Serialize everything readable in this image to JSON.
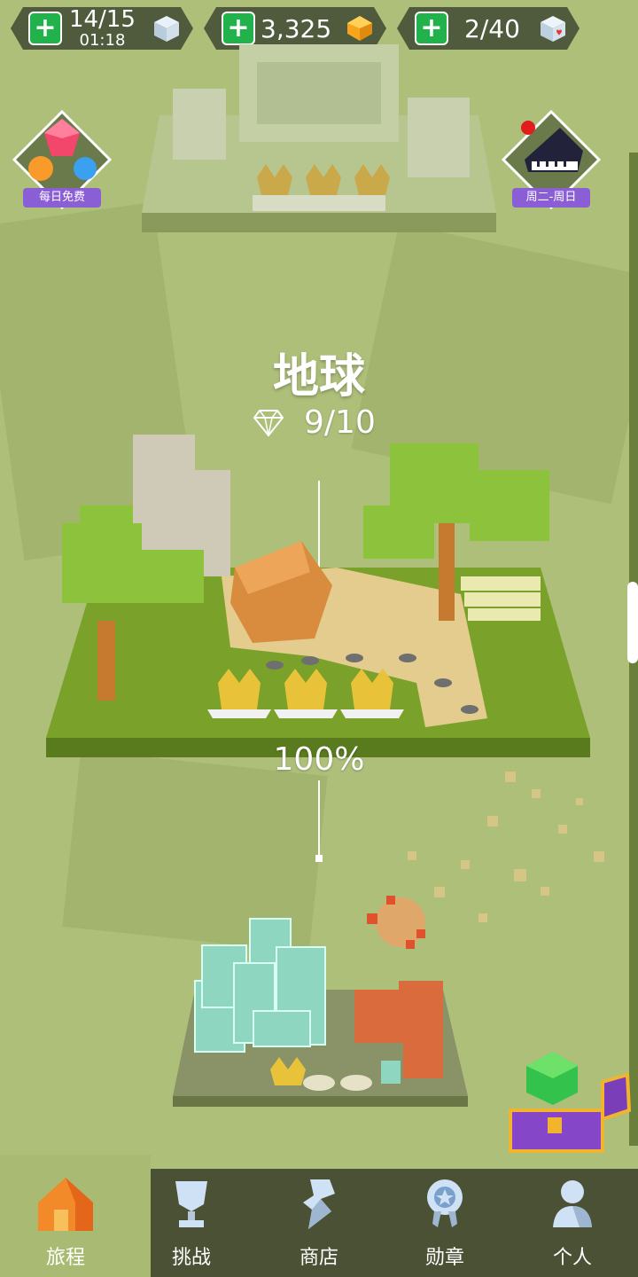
{
  "top_bar": {
    "lives": {
      "value": "14/15",
      "timer": "01:18",
      "icon": "white-cube-icon"
    },
    "gems": {
      "value": "3,325",
      "icon": "orange-gem-icon"
    },
    "hearts": {
      "value": "2/40",
      "icon": "heart-cube-icon"
    },
    "add_icon": "plus-icon"
  },
  "side": {
    "daily_free_label": "每日免费",
    "piano_label": "周二-周日"
  },
  "level": {
    "title": "地球",
    "gems_progress": "9/10",
    "completion": "100%"
  },
  "nav": {
    "items": [
      {
        "label": "旅程",
        "icon": "home-icon",
        "active": true
      },
      {
        "label": "挑战",
        "icon": "trophy-icon"
      },
      {
        "label": "商店",
        "icon": "shop-icon"
      },
      {
        "label": "勋章",
        "icon": "medal-icon"
      },
      {
        "label": "个人",
        "icon": "person-icon"
      }
    ]
  },
  "colors": {
    "background": "#aebf7a",
    "nav_bg": "#4b5134",
    "plus_green": "#22b24c",
    "label_purple": "#8a5fd6"
  }
}
